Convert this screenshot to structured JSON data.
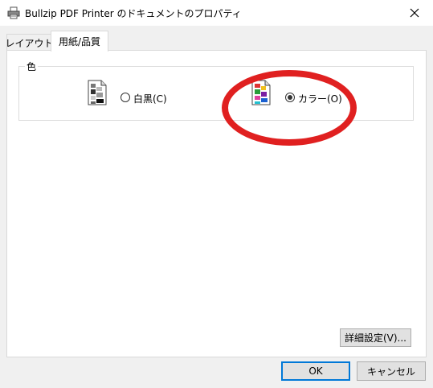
{
  "window": {
    "title": "Bullzip PDF Printer のドキュメントのプロパティ",
    "close_icon": "close-icon"
  },
  "tabs": [
    {
      "label": "レイアウト",
      "selected": false
    },
    {
      "label": "用紙/品質",
      "selected": true
    }
  ],
  "color_group": {
    "label": "色",
    "options": [
      {
        "label": "白黒(C)",
        "selected": false,
        "icon": "monochrome-printer-icon"
      },
      {
        "label": "カラー(O)",
        "selected": true,
        "icon": "color-printer-icon"
      }
    ],
    "highlight_color": "#e02020"
  },
  "buttons": {
    "advanced": "詳細設定(V)...",
    "ok": "OK",
    "cancel": "キャンセル"
  },
  "colors": {
    "accent": "#0078d7",
    "annotation": "#e02020"
  }
}
